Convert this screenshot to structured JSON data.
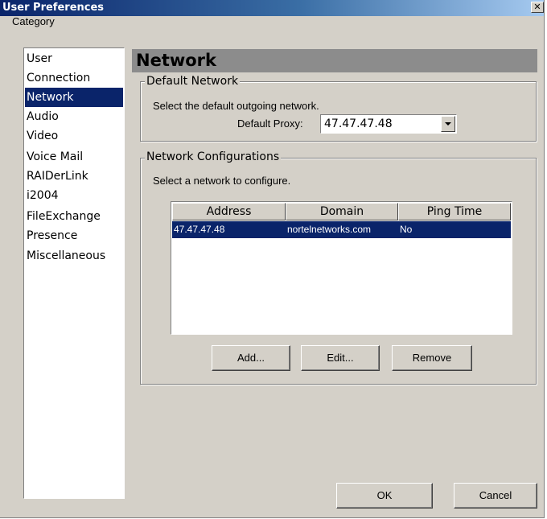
{
  "window": {
    "title": "User Preferences",
    "close_glyph": "✕"
  },
  "category": {
    "label": "Category",
    "items": [
      {
        "label": "User"
      },
      {
        "label": "Connection"
      },
      {
        "label": "Network",
        "selected": true
      },
      {
        "label": "Audio"
      },
      {
        "label": "Video"
      },
      {
        "label": "Voice Mail"
      },
      {
        "label": "RAIDerLink"
      },
      {
        "label": "i2004"
      },
      {
        "label": "FileExchange"
      },
      {
        "label": "Presence"
      },
      {
        "label": "Miscellaneous"
      }
    ]
  },
  "panel": {
    "title": "Network",
    "default_network": {
      "legend": "Default Network",
      "description": "Select the default outgoing network.",
      "proxy_label": "Default Proxy:",
      "proxy_value": "47.47.47.48"
    },
    "configurations": {
      "legend": "Network Configurations",
      "description": "Select a network to configure.",
      "columns": [
        "Address",
        "Domain",
        "Ping Time"
      ],
      "rows": [
        {
          "address": "47.47.47.48",
          "domain": "nortelnetworks.com",
          "ping": "No",
          "selected": true
        }
      ],
      "buttons": {
        "add": "Add...",
        "edit": "Edit...",
        "remove": "Remove"
      }
    }
  },
  "footer": {
    "ok": "OK",
    "cancel": "Cancel"
  },
  "colors": {
    "face": "#d4d0c8",
    "selection": "#0a246a",
    "header": "#8c8c8c"
  }
}
